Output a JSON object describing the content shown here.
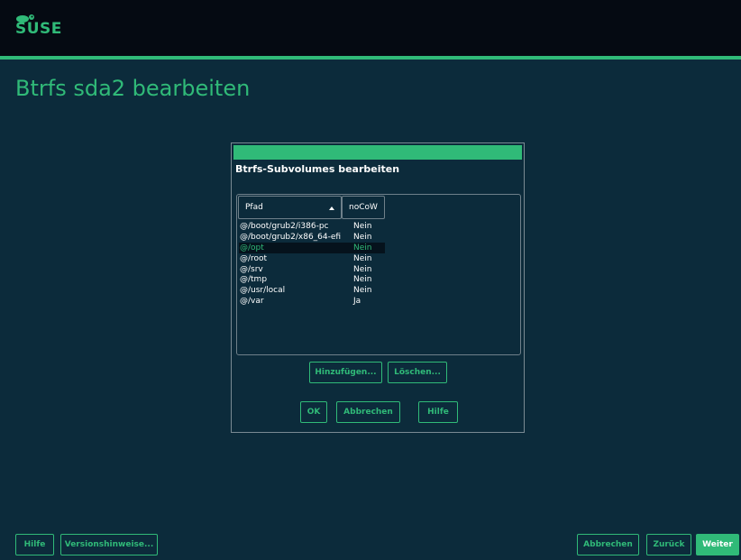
{
  "brand": {
    "logo_text": "SUSE"
  },
  "page": {
    "title": "Btrfs sda2 bearbeiten"
  },
  "dialog": {
    "heading": "Btrfs-Subvolumes bearbeiten",
    "columns": {
      "path": "Pfad",
      "nocow": "noCoW"
    },
    "rows": [
      {
        "path": "@/boot/grub2/i386-pc",
        "nocow": "Nein"
      },
      {
        "path": "@/boot/grub2/x86_64-efi",
        "nocow": "Nein"
      },
      {
        "path": "@/opt",
        "nocow": "Nein"
      },
      {
        "path": "@/root",
        "nocow": "Nein"
      },
      {
        "path": "@/srv",
        "nocow": "Nein"
      },
      {
        "path": "@/tmp",
        "nocow": "Nein"
      },
      {
        "path": "@/usr/local",
        "nocow": "Nein"
      },
      {
        "path": "@/var",
        "nocow": "Ja"
      }
    ],
    "selected_row": "@/opt",
    "buttons": {
      "add": "Hinzufügen...",
      "delete": "Löschen...",
      "ok": "OK",
      "cancel": "Abbrechen",
      "help": "Hilfe"
    }
  },
  "footer": {
    "help": "Hilfe",
    "release_notes": "Versionshinweise...",
    "abort": "Abbrechen",
    "back": "Zurück",
    "next": "Weiter"
  },
  "colors": {
    "accent": "#30ba78",
    "background": "#0c2b3b",
    "header": "#050a12"
  }
}
